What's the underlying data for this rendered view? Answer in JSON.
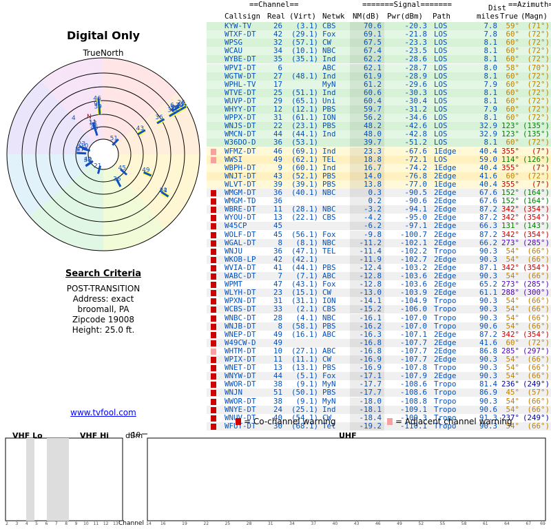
{
  "left": {
    "title": "Digital Only",
    "compass_label": "TrueNorth",
    "criteria_heading": "Search Criteria",
    "criteria_lines": [
      "POST-TRANSITION",
      "Address: exact",
      "broomall, PA",
      "Zipcode 19008",
      "Height: 25.0 ft."
    ],
    "site_link": "www.tvfool.com"
  },
  "table": {
    "header_top": [
      "==Channel==",
      "=======Signal=======",
      "Dist",
      "==Azimuth=="
    ],
    "header_cols": [
      "Callsign",
      "Real",
      "(Virt)",
      "Netwk",
      "NM(dB)",
      "Pwr(dBm)",
      "Path",
      "miles",
      "True",
      "(Magn)"
    ],
    "rows": [
      [
        "KYW-TV",
        "26",
        "(3.1)",
        "CBS",
        "70.6",
        "-20.3",
        "LOS",
        "7.8",
        "59°",
        "(71°)",
        0,
        0,
        "g"
      ],
      [
        "WTXF-DT",
        "42",
        "(29.1)",
        "Fox",
        "69.1",
        "-21.8",
        "LOS",
        "7.8",
        "60°",
        "(72°)",
        0,
        0,
        "g"
      ],
      [
        "WPSG",
        "32",
        "(57.1)",
        "CW",
        "67.5",
        "-23.3",
        "LOS",
        "8.1",
        "60°",
        "(72°)",
        0,
        0,
        "g"
      ],
      [
        "WCAU",
        "34",
        "(10.1)",
        "NBC",
        "67.4",
        "-23.5",
        "LOS",
        "8.1",
        "60°",
        "(72°)",
        0,
        0,
        "g"
      ],
      [
        "WYBE-DT",
        "35",
        "(35.1)",
        "Ind",
        "62.2",
        "-28.6",
        "LOS",
        "8.1",
        "60°",
        "(72°)",
        0,
        0,
        "g"
      ],
      [
        "WPVI-DT",
        "6",
        "",
        "ABC",
        "62.1",
        "-28.7",
        "LOS",
        "8.0",
        "58°",
        "(70°)",
        0,
        0,
        "g"
      ],
      [
        "WGTW-DT",
        "27",
        "(48.1)",
        "Ind",
        "61.9",
        "-28.9",
        "LOS",
        "8.1",
        "60°",
        "(72°)",
        0,
        0,
        "g"
      ],
      [
        "WPHL-TV",
        "17",
        "",
        "MyN",
        "61.2",
        "-29.6",
        "LOS",
        "7.9",
        "60°",
        "(72°)",
        0,
        0,
        "g"
      ],
      [
        "WTVE-DT",
        "25",
        "(51.1)",
        "Ind",
        "60.6",
        "-30.3",
        "LOS",
        "8.1",
        "60°",
        "(72°)",
        0,
        0,
        "g"
      ],
      [
        "WUVP-DT",
        "29",
        "(65.1)",
        "Uni",
        "60.4",
        "-30.4",
        "LOS",
        "8.1",
        "60°",
        "(72°)",
        0,
        0,
        "g"
      ],
      [
        "WHYY-DT",
        "12",
        "(12.1)",
        "PBS",
        "59.7",
        "-31.2",
        "LOS",
        "7.9",
        "60°",
        "(72°)",
        0,
        0,
        "g"
      ],
      [
        "WPPX-DT",
        "31",
        "(61.1)",
        "ION",
        "56.2",
        "-34.6",
        "LOS",
        "8.1",
        "60°",
        "(72°)",
        0,
        0,
        "g"
      ],
      [
        "WNJS-DT",
        "22",
        "(23.1)",
        "PBS",
        "48.2",
        "-42.6",
        "LOS",
        "32.9",
        "123°",
        "(135°)",
        0,
        0,
        "g"
      ],
      [
        "WMCN-DT",
        "44",
        "(44.1)",
        "Ind",
        "48.0",
        "-42.8",
        "LOS",
        "32.9",
        "123°",
        "(135°)",
        0,
        0,
        "g"
      ],
      [
        "W36DO-D",
        "36",
        "(53.1)",
        "",
        "39.7",
        "-51.2",
        "LOS",
        "8.1",
        "60°",
        "(72°)",
        0,
        0,
        "g"
      ],
      [
        "WFMZ-DT",
        "46",
        "(69.1)",
        "Ind",
        "23.3",
        "-67.6",
        "1Edge",
        "40.4",
        "355°",
        "(7°)",
        0,
        1,
        "y"
      ],
      [
        "WWSI",
        "49",
        "(62.1)",
        "TEL",
        "18.8",
        "-72.1",
        "LOS",
        "59.0",
        "114°",
        "(126°)",
        0,
        1,
        "y"
      ],
      [
        "WBPH-DT",
        "9",
        "(60.1)",
        "Ind",
        "16.7",
        "-74.2",
        "1Edge",
        "40.4",
        "355°",
        "(7°)",
        0,
        0,
        "y"
      ],
      [
        "WNJT-DT",
        "43",
        "(52.1)",
        "PBS",
        "14.0",
        "-76.8",
        "2Edge",
        "41.6",
        "60°",
        "(72°)",
        0,
        0,
        "y"
      ],
      [
        "WLVT-DT",
        "39",
        "(39.1)",
        "PBS",
        "13.8",
        "-77.0",
        "1Edge",
        "40.4",
        "355°",
        "(7°)",
        0,
        0,
        "y"
      ],
      [
        "WMGM-DT",
        "36",
        "(40.1)",
        "NBC",
        "0.3",
        "-90.5",
        "2Edge",
        "67.6",
        "152°",
        "(164°)",
        1,
        0,
        "w"
      ],
      [
        "WMGM-TD",
        "36",
        "",
        "",
        "0.2",
        "-90.6",
        "2Edge",
        "67.6",
        "152°",
        "(164°)",
        1,
        0,
        "w"
      ],
      [
        "WBRE-DT",
        "11",
        "(28.1)",
        "NBC",
        "-3.2",
        "-94.1",
        "2Edge",
        "87.2",
        "342°",
        "(354°)",
        1,
        0,
        "w"
      ],
      [
        "WYOU-DT",
        "13",
        "(22.1)",
        "CBS",
        "-4.2",
        "-95.0",
        "2Edge",
        "87.2",
        "342°",
        "(354°)",
        1,
        0,
        "w"
      ],
      [
        "W45CP",
        "45",
        "",
        "",
        "-6.2",
        "-97.1",
        "2Edge",
        "66.3",
        "131°",
        "(143°)",
        1,
        0,
        "w"
      ],
      [
        "WOLF-DT",
        "45",
        "(56.1)",
        "Fox",
        "-9.8",
        "-100.7",
        "2Edge",
        "87.2",
        "342°",
        "(354°)",
        1,
        0,
        "w"
      ],
      [
        "WGAL-DT",
        "8",
        "(8.1)",
        "NBC",
        "-11.2",
        "-102.1",
        "2Edge",
        "66.2",
        "273°",
        "(285°)",
        1,
        0,
        "w"
      ],
      [
        "WNJU",
        "36",
        "(47.1)",
        "TEL",
        "-11.4",
        "-102.2",
        "Tropo",
        "90.3",
        "54°",
        "(66°)",
        1,
        0,
        "w"
      ],
      [
        "WKOB-LP",
        "42",
        "(42.1)",
        "",
        "-11.9",
        "-102.7",
        "2Edge",
        "90.3",
        "54°",
        "(66°)",
        1,
        0,
        "w"
      ],
      [
        "WVIA-DT",
        "41",
        "(44.1)",
        "PBS",
        "-12.4",
        "-103.2",
        "2Edge",
        "87.1",
        "342°",
        "(354°)",
        1,
        0,
        "w"
      ],
      [
        "WABC-DT",
        "7",
        "(7.1)",
        "ABC",
        "-12.8",
        "-103.6",
        "2Edge",
        "90.3",
        "54°",
        "(66°)",
        1,
        0,
        "w"
      ],
      [
        "WPMT",
        "47",
        "(43.1)",
        "Fox",
        "-12.8",
        "-103.6",
        "2Edge",
        "65.2",
        "273°",
        "(285°)",
        1,
        0,
        "w"
      ],
      [
        "WLYH-DT",
        "23",
        "(15.1)",
        "CW",
        "-13.0",
        "-103.9",
        "2Edge",
        "61.1",
        "288°",
        "(300°)",
        1,
        0,
        "w"
      ],
      [
        "WPXN-DT",
        "31",
        "(31.1)",
        "ION",
        "-14.1",
        "-104.9",
        "Tropo",
        "90.3",
        "54°",
        "(66°)",
        1,
        0,
        "w"
      ],
      [
        "WCBS-DT",
        "33",
        "(2.1)",
        "CBS",
        "-15.2",
        "-106.0",
        "Tropo",
        "90.3",
        "54°",
        "(66°)",
        1,
        0,
        "w"
      ],
      [
        "WNBC-DT",
        "28",
        "(4.1)",
        "NBC",
        "-16.1",
        "-107.0",
        "Tropo",
        "90.3",
        "54°",
        "(66°)",
        1,
        0,
        "w"
      ],
      [
        "WNJB-DT",
        "8",
        "(58.1)",
        "PBS",
        "-16.2",
        "-107.0",
        "Tropo",
        "90.6",
        "54°",
        "(66°)",
        1,
        0,
        "w"
      ],
      [
        "WNEP-DT",
        "49",
        "(16.1)",
        "ABC",
        "-16.3",
        "-107.1",
        "2Edge",
        "87.2",
        "342°",
        "(354°)",
        1,
        0,
        "w"
      ],
      [
        "W49CW-D",
        "49",
        "",
        "",
        "-16.8",
        "-107.7",
        "2Edge",
        "41.6",
        "60°",
        "(72°)",
        1,
        0,
        "w"
      ],
      [
        "WHTM-DT",
        "10",
        "(27.1)",
        "ABC",
        "-16.8",
        "-107.7",
        "2Edge",
        "86.8",
        "285°",
        "(297°)",
        0,
        1,
        "w"
      ],
      [
        "WPIX-DT",
        "11",
        "(11.1)",
        "CW",
        "-16.9",
        "-107.7",
        "2Edge",
        "90.3",
        "54°",
        "(66°)",
        1,
        0,
        "w"
      ],
      [
        "WNET-DT",
        "13",
        "(13.1)",
        "PBS",
        "-16.9",
        "-107.8",
        "Tropo",
        "90.3",
        "54°",
        "(66°)",
        1,
        0,
        "w"
      ],
      [
        "WNYW-DT",
        "44",
        "(5.1)",
        "Fox",
        "-17.1",
        "-107.9",
        "2Edge",
        "90.3",
        "54°",
        "(66°)",
        1,
        0,
        "w"
      ],
      [
        "WWOR-DT",
        "38",
        "(9.1)",
        "MyN",
        "-17.7",
        "-108.6",
        "Tropo",
        "81.4",
        "236°",
        "(249°)",
        1,
        0,
        "w"
      ],
      [
        "WNJN",
        "51",
        "(50.1)",
        "PBS",
        "-17.7",
        "-108.6",
        "Tropo",
        "86.9",
        "45°",
        "(57°)",
        1,
        0,
        "w"
      ],
      [
        "WWOR-DT",
        "38",
        "(9.1)",
        "MyN",
        "-18.0",
        "-108.8",
        "Tropo",
        "90.3",
        "54°",
        "(66°)",
        1,
        0,
        "w"
      ],
      [
        "WNYE-DT",
        "24",
        "(25.1)",
        "Ind",
        "-18.1",
        "-109.1",
        "Tropo",
        "90.6",
        "54°",
        "(66°)",
        1,
        0,
        "w"
      ],
      [
        "WNUV-DT",
        "40",
        "(54.1)",
        "CW",
        "-18.4",
        "-109.3",
        "Tropo",
        "91.3",
        "237°",
        "(249°)",
        1,
        0,
        "w"
      ],
      [
        "WFUT-DT",
        "30",
        "(68.1)",
        "Tel",
        "-19.2",
        "-110.1",
        "Tropo",
        "90.3",
        "54°",
        "(66°)",
        1,
        0,
        "w"
      ]
    ]
  },
  "legend": {
    "co_channel": "= Co-channel warning",
    "adjacent": "= Adjacent channel warning"
  },
  "bottom": {
    "band_labels": [
      "VHF Lo",
      "VHF Hi",
      "dBm",
      "UHF"
    ],
    "dbm_ticks": [
      "-10",
      "-20",
      "-30",
      "-40",
      "-50",
      "-60",
      "-70",
      "-80",
      "-90"
    ],
    "channel_label": "Channel",
    "vhf_ticks": [
      "2",
      "3",
      "4",
      "5",
      "6",
      "7",
      "8",
      "9",
      "10",
      "11",
      "12",
      "13"
    ],
    "uhf_ticks": [
      "14",
      "16",
      "19",
      "22",
      "25",
      "28",
      "31",
      "34",
      "37",
      "40",
      "43",
      "46",
      "49",
      "52",
      "55",
      "58",
      "61",
      "64",
      "67",
      "69"
    ],
    "stations": [
      {
        "label": "WPVI-DT",
        "ch": 6,
        "dbm": -28.7,
        "band": "vhf",
        "hl": true
      },
      {
        "label": "WBPH-DT",
        "ch": 9,
        "dbm": -74.2,
        "band": "vhf",
        "hl": true
      },
      {
        "label": "WHYY-DT",
        "ch": 12,
        "dbm": -31.2,
        "band": "vhf",
        "hl": true
      },
      {
        "label": "WBRE-DT",
        "ch": 11,
        "dbm": -94.1,
        "band": "vhf",
        "faint": true
      },
      {
        "label": "WYOU-DT",
        "ch": 13,
        "dbm": -95.0,
        "band": "vhf",
        "faint": true
      },
      {
        "label": "WPHL-TV",
        "ch": 17,
        "dbm": -29.6,
        "band": "uhf"
      },
      {
        "label": "WNJS-DT",
        "ch": 22,
        "dbm": -42.6,
        "band": "uhf"
      },
      {
        "label": "WTVE-DT",
        "ch": 25,
        "dbm": -30.3,
        "band": "uhf"
      },
      {
        "label": "KYW-TV",
        "ch": 26,
        "dbm": -20.3,
        "band": "uhf"
      },
      {
        "label": "WGTW-DT",
        "ch": 27,
        "dbm": -28.9,
        "band": "uhf"
      },
      {
        "label": "WUVP-DT",
        "ch": 29,
        "dbm": -30.4,
        "band": "uhf"
      },
      {
        "label": "WPPX-DT",
        "ch": 31,
        "dbm": -34.6,
        "band": "uhf"
      },
      {
        "label": "WPSG",
        "ch": 32,
        "dbm": -23.3,
        "band": "uhf"
      },
      {
        "label": "WCAU",
        "ch": 34,
        "dbm": -23.5,
        "band": "uhf"
      },
      {
        "label": "WYBE-DT",
        "ch": 35,
        "dbm": -28.6,
        "band": "uhf"
      },
      {
        "label": "W36DO-D",
        "ch": 36,
        "dbm": -51.2,
        "band": "uhf"
      },
      {
        "label": "WMGM-DT",
        "ch": 36,
        "dbm": -90.5,
        "band": "uhf",
        "faint": true
      },
      {
        "label": "WLVT-DT",
        "ch": 39,
        "dbm": -77.0,
        "band": "uhf"
      },
      {
        "label": "WTXF-DT",
        "ch": 42,
        "dbm": -21.8,
        "band": "uhf"
      },
      {
        "label": "WNJT-DT",
        "ch": 43,
        "dbm": -76.8,
        "band": "uhf"
      },
      {
        "label": "WMCN-DT",
        "ch": 44,
        "dbm": -42.8,
        "band": "uhf"
      },
      {
        "label": "W45CP",
        "ch": 45,
        "dbm": -97.1,
        "band": "uhf",
        "faint": true
      },
      {
        "label": "WFMZ-DT",
        "ch": 46,
        "dbm": -67.6,
        "band": "uhf"
      },
      {
        "label": "WWSI",
        "ch": 49,
        "dbm": -72.1,
        "band": "uhf"
      }
    ]
  },
  "polar": {
    "stations": [
      {
        "ch": "26",
        "az": 59,
        "nm": 70.6
      },
      {
        "ch": "42",
        "az": 60,
        "nm": 69.1
      },
      {
        "ch": "32",
        "az": 60,
        "nm": 67.5
      },
      {
        "ch": "34",
        "az": 60,
        "nm": 67.4
      },
      {
        "ch": "35",
        "az": 60,
        "nm": 62.2
      },
      {
        "ch": "6",
        "az": 58,
        "nm": 62.1
      },
      {
        "ch": "27",
        "az": 60,
        "nm": 61.9
      },
      {
        "ch": "17",
        "az": 60,
        "nm": 61.2
      },
      {
        "ch": "25",
        "az": 60,
        "nm": 60.6
      },
      {
        "ch": "29",
        "az": 60,
        "nm": 60.4
      },
      {
        "ch": "12",
        "az": 60,
        "nm": 59.7
      },
      {
        "ch": "31",
        "az": 60,
        "nm": 56.2
      },
      {
        "ch": "22",
        "az": 123,
        "nm": 48.2
      },
      {
        "ch": "44",
        "az": 123,
        "nm": 48.0
      },
      {
        "ch": "36",
        "az": 60,
        "nm": 39.7
      },
      {
        "ch": "46",
        "az": 355,
        "nm": 23.3
      },
      {
        "ch": "49",
        "az": 114,
        "nm": 18.8
      },
      {
        "ch": "9",
        "az": 355,
        "nm": 16.7
      },
      {
        "ch": "43",
        "az": 60,
        "nm": 14.0
      },
      {
        "ch": "39",
        "az": 355,
        "nm": 13.8
      },
      {
        "ch": "36",
        "az": 152,
        "nm": 0.3
      },
      {
        "ch": "11",
        "az": 342,
        "nm": -3.2
      },
      {
        "ch": "13",
        "az": 342,
        "nm": -4.2
      },
      {
        "ch": "45",
        "az": 131,
        "nm": -6.2
      },
      {
        "ch": "45",
        "az": 342,
        "nm": -9.8
      },
      {
        "ch": "8",
        "az": 273,
        "nm": -11.2
      },
      {
        "ch": "47",
        "az": 273,
        "nm": -12.8
      },
      {
        "ch": "23",
        "az": 288,
        "nm": -13.0
      },
      {
        "ch": "10",
        "az": 285,
        "nm": -16.8
      },
      {
        "ch": "38",
        "az": 236,
        "nm": -17.7
      },
      {
        "ch": "51",
        "az": 45,
        "nm": -17.7
      },
      {
        "ch": "40",
        "az": 237,
        "nm": -18.4
      },
      {
        "ch": "21",
        "az": 195,
        "nm": -19.0
      }
    ],
    "north_label": "N",
    "north_channels": "4",
    "north_dot_label": "1"
  }
}
